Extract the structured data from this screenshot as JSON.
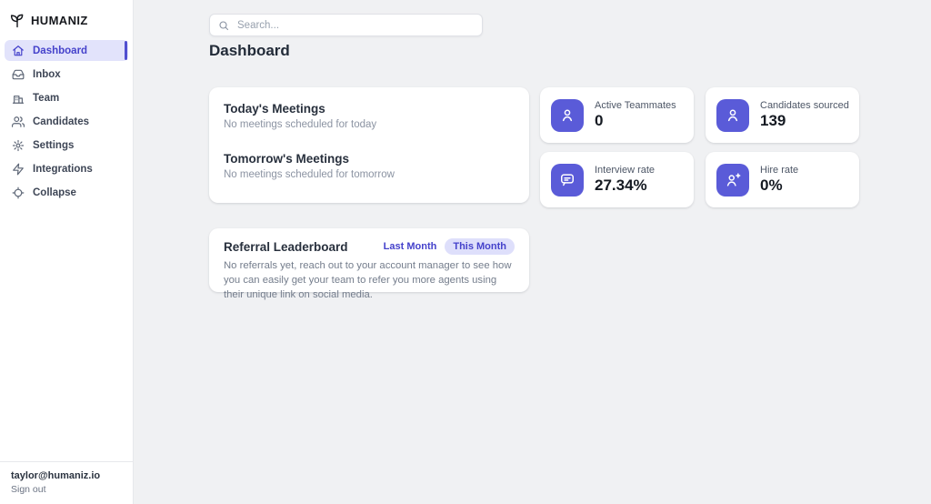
{
  "app": {
    "brand": "HUMANIZ"
  },
  "sidebar": {
    "items": [
      {
        "label": "Dashboard",
        "icon": "home-icon",
        "active": true
      },
      {
        "label": "Inbox",
        "icon": "inbox-icon",
        "active": false
      },
      {
        "label": "Team",
        "icon": "building-icon",
        "active": false
      },
      {
        "label": "Candidates",
        "icon": "people-icon",
        "active": false
      },
      {
        "label": "Settings",
        "icon": "gear-icon",
        "active": false
      },
      {
        "label": "Integrations",
        "icon": "zap-icon",
        "active": false
      },
      {
        "label": "Collapse",
        "icon": "collapse-icon",
        "active": false
      }
    ],
    "user_email": "taylor@humaniz.io",
    "sign_out_label": "Sign out"
  },
  "search": {
    "placeholder": "Search..."
  },
  "page": {
    "title": "Dashboard"
  },
  "meetings": {
    "today": {
      "title": "Today's Meetings",
      "empty_text": "No meetings scheduled for today"
    },
    "tomorrow": {
      "title": "Tomorrow's Meetings",
      "empty_text": "No meetings scheduled for tomorrow"
    }
  },
  "stats": [
    {
      "label": "Active Teammates",
      "value": "0",
      "icon": "person-icon"
    },
    {
      "label": "Candidates sourced",
      "value": "139",
      "icon": "person-icon"
    },
    {
      "label": "Interview rate",
      "value": "27.34%",
      "icon": "chat-bubble-icon"
    },
    {
      "label": "Hire rate",
      "value": "0%",
      "icon": "person-plus-icon"
    }
  ],
  "referral": {
    "title": "Referral Leaderboard",
    "tabs": [
      {
        "label": "Last Month",
        "active": false
      },
      {
        "label": "This Month",
        "active": true
      }
    ],
    "empty_text": "No referrals yet, reach out to your account manager to see how you can easily get your team to refer you more agents using their unique link on social media."
  },
  "colors": {
    "accent": "#5a5bd8",
    "accent_text": "#4542cb",
    "accent_soft": "#e2e3fb",
    "pill_background": "#dedffb",
    "page_background": "#f0f1f3",
    "card_background": "#ffffff"
  }
}
